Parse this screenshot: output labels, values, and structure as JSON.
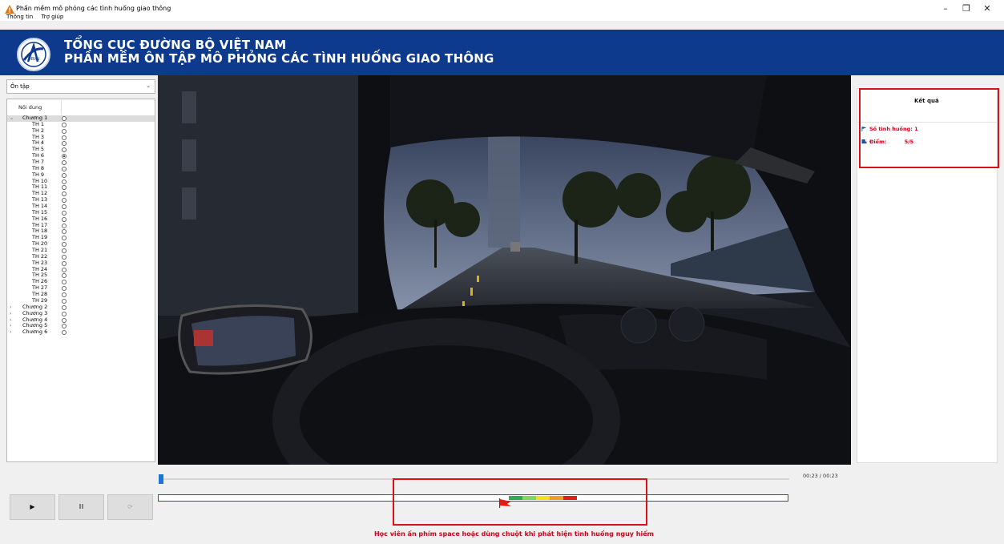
{
  "app_title": "Phần mềm mô phỏng các tình huống giao thông",
  "menu": [
    "Thông tin",
    "Trợ giúp"
  ],
  "window_controls": {
    "minimize": "–",
    "restore": "❐",
    "close": "✕"
  },
  "header": {
    "logo_text": "DBVN",
    "line1": "TỔNG CỤC ĐƯỜNG BỘ VIỆT NAM",
    "line2": "PHẦN MỀM ÔN TẬP MÔ PHỎNG CÁC TÌNH HUỐNG GIAO THÔNG"
  },
  "mode_select": {
    "value": "Ôn tập"
  },
  "tree": {
    "header": "Nội dung",
    "rows": [
      {
        "label": "Chương 1",
        "level": 0,
        "expanded": true,
        "selected": true,
        "checked": false
      },
      {
        "label": "TH 1",
        "level": 1,
        "checked": false
      },
      {
        "label": "TH 2",
        "level": 1,
        "checked": false
      },
      {
        "label": "TH 3",
        "level": 1,
        "checked": false
      },
      {
        "label": "TH 4",
        "level": 1,
        "checked": false
      },
      {
        "label": "TH 5",
        "level": 1,
        "checked": false
      },
      {
        "label": "TH 6",
        "level": 1,
        "checked": true
      },
      {
        "label": "TH 7",
        "level": 1,
        "checked": false
      },
      {
        "label": "TH 8",
        "level": 1,
        "checked": false
      },
      {
        "label": "TH 9",
        "level": 1,
        "checked": false
      },
      {
        "label": "TH 10",
        "level": 1,
        "checked": false
      },
      {
        "label": "TH 11",
        "level": 1,
        "checked": false
      },
      {
        "label": "TH 12",
        "level": 1,
        "checked": false
      },
      {
        "label": "TH 13",
        "level": 1,
        "checked": false
      },
      {
        "label": "TH 14",
        "level": 1,
        "checked": false
      },
      {
        "label": "TH 15",
        "level": 1,
        "checked": false
      },
      {
        "label": "TH 16",
        "level": 1,
        "checked": false
      },
      {
        "label": "TH 17",
        "level": 1,
        "checked": false
      },
      {
        "label": "TH 18",
        "level": 1,
        "checked": false
      },
      {
        "label": "TH 19",
        "level": 1,
        "checked": false
      },
      {
        "label": "TH 20",
        "level": 1,
        "checked": false
      },
      {
        "label": "TH 21",
        "level": 1,
        "checked": false
      },
      {
        "label": "TH 22",
        "level": 1,
        "checked": false
      },
      {
        "label": "TH 23",
        "level": 1,
        "checked": false
      },
      {
        "label": "TH 24",
        "level": 1,
        "checked": false
      },
      {
        "label": "TH 25",
        "level": 1,
        "checked": false
      },
      {
        "label": "TH 26",
        "level": 1,
        "checked": false
      },
      {
        "label": "TH 27",
        "level": 1,
        "checked": false
      },
      {
        "label": "TH 28",
        "level": 1,
        "checked": false
      },
      {
        "label": "TH 29",
        "level": 1,
        "checked": false
      },
      {
        "label": "Chương 2",
        "level": 0,
        "expanded": false,
        "checked": false
      },
      {
        "label": "Chương 3",
        "level": 0,
        "expanded": false,
        "checked": false
      },
      {
        "label": "Chương 4",
        "level": 0,
        "expanded": false,
        "checked": false
      },
      {
        "label": "Chương 5",
        "level": 0,
        "expanded": false,
        "checked": false
      },
      {
        "label": "Chương 6",
        "level": 0,
        "expanded": false,
        "checked": false
      }
    ]
  },
  "result": {
    "title": "Kết quả",
    "count_label": "Số tình huống:",
    "count_value": "1",
    "score_label": "Điểm:",
    "score_value": "5/5"
  },
  "player": {
    "time": "00:23 / 00:23",
    "progress": 0.0,
    "buttons": [
      {
        "name": "play-button",
        "icon": "play-icon"
      },
      {
        "name": "pause-button",
        "icon": "pause-icon"
      },
      {
        "name": "refresh-button",
        "icon": "refresh-icon"
      }
    ]
  },
  "score_bands": [
    "#34a853",
    "#7ed957",
    "#f7e019",
    "#f59a23",
    "#e31b1b"
  ],
  "hint": "Học viên ấn phím space hoặc dùng chuột khi phát hiện tình huống nguy hiểm",
  "colors": {
    "header_bg": "#0d3a8c",
    "accent_red": "#d0021b",
    "seek_thumb": "#1c77d4"
  }
}
